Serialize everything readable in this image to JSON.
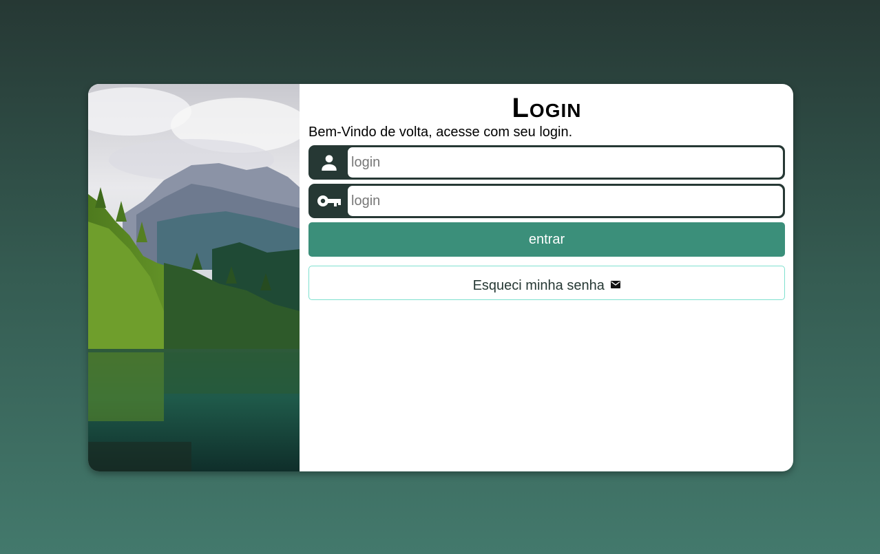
{
  "form": {
    "title": "Login",
    "subtitle": "Bem-Vindo de volta, acesse com seu login.",
    "user_field": {
      "placeholder": "login",
      "icon": "user-icon"
    },
    "password_field": {
      "placeholder": "login",
      "icon": "key-icon"
    },
    "submit_label": "entrar",
    "forgot_label": "Esqueci minha senha",
    "forgot_icon": "mail-icon"
  },
  "colors": {
    "dark_green": "#263834",
    "accent": "#3b8f7a",
    "forgot_border": "#7ee0cf"
  }
}
